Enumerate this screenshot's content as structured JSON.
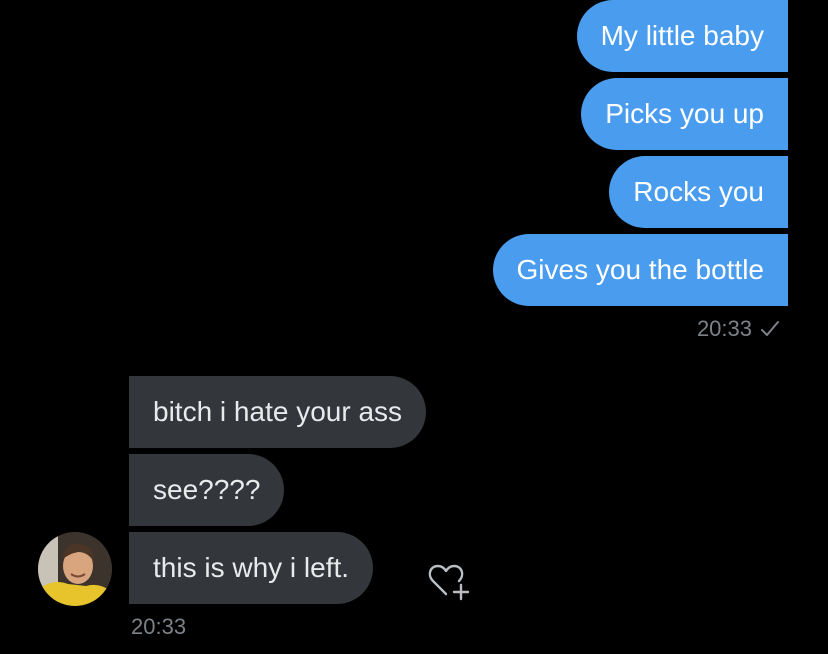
{
  "sent_messages": [
    {
      "text": "My little baby"
    },
    {
      "text": "Picks you up"
    },
    {
      "text": "Rocks you"
    },
    {
      "text": "Gives you the bottle"
    }
  ],
  "sent_timestamp": "20:33",
  "received_messages": [
    {
      "text": "bitch i hate your ass"
    },
    {
      "text": "see????"
    },
    {
      "text": "this is why i left."
    }
  ],
  "received_timestamp": "20:33",
  "icons": {
    "read_receipt": "checkmark-icon",
    "react": "heart-plus-icon",
    "avatar": "avatar"
  },
  "colors": {
    "background": "#000000",
    "sent_bubble": "#4a9cee",
    "received_bubble": "#33373b",
    "timestamp": "#7c8288"
  }
}
